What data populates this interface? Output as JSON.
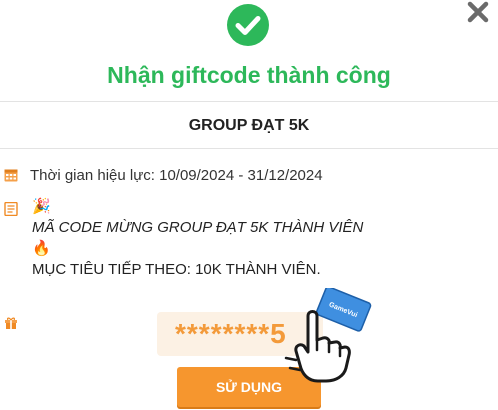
{
  "header": {
    "title": "Nhận giftcode thành công",
    "success_icon": "check-circle-icon",
    "close_icon": "close-x-icon"
  },
  "event": {
    "name": "GROUP ĐẠT 5K",
    "validity_icon": "calendar-icon",
    "validity": "Thời gian hiệu lực: 10/09/2024 - 31/12/2024"
  },
  "description": {
    "icon": "document-icon",
    "party_emoji": "🎉",
    "line1": "MÃ CODE MỪNG GROUP ĐẠT 5K THÀNH VIÊN",
    "fire_emoji": "🔥",
    "line2": "MỤC TIÊU TIẾP THEO: 10K THÀNH VIÊN."
  },
  "gift": {
    "icon": "gift-icon",
    "code_masked": "********5",
    "use_button_label": "SỬ DỤNG",
    "card_label": "GameVui"
  },
  "colors": {
    "success_green": "#2db85a",
    "accent_orange": "#f6962e",
    "code_bg": "#fcf1e4",
    "card_blue": "#3f8fe0"
  }
}
